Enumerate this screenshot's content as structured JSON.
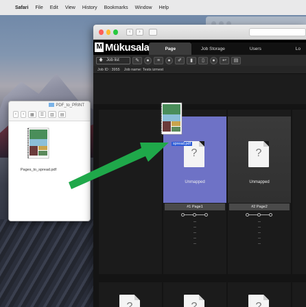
{
  "menubar": {
    "apple": "",
    "items": [
      "Safari",
      "File",
      "Edit",
      "View",
      "History",
      "Bookmarks",
      "Window",
      "Help"
    ]
  },
  "finder": {
    "title": "PDF_to_PRINT",
    "file_name": "Pages_to_spread.pdf"
  },
  "app": {
    "brand": "Mükusala",
    "brand_mark": "M",
    "tabs": [
      "Page",
      "Job Storage",
      "Users",
      "Lo"
    ],
    "toolbar": {
      "job_list": "Job list"
    },
    "info": {
      "job_id": "Job ID : 3955",
      "job_name": "Job name: Tests izmest"
    },
    "pages": [
      {
        "status": "Unmapped",
        "name": "#1 Page1",
        "dashes": [
          "--",
          "--",
          "--",
          "--",
          "--"
        ],
        "selected": true
      },
      {
        "status": "Unmapped",
        "name": "#2 Page2",
        "dashes": [
          "--",
          "--",
          "--",
          "--",
          "--"
        ],
        "selected": false
      }
    ],
    "drag_label": "spread.pdf"
  },
  "colors": {
    "selected_thumb": "#6e72c6",
    "arrow": "#1fa84a",
    "drag_label_bg": "#2a5bd8"
  }
}
